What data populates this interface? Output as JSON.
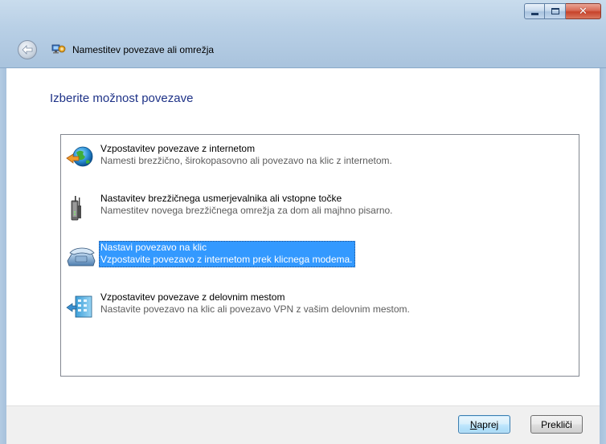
{
  "window": {
    "title": "Namestitev povezave ali omrežja",
    "caption_buttons": {
      "minimize_icon": "minimize-icon",
      "maximize_icon": "maximize-icon",
      "close_icon": "close-icon",
      "close_glyph": "✕"
    },
    "back_icon": "back-arrow-icon"
  },
  "page": {
    "heading": "Izberite možnost povezave"
  },
  "options": [
    {
      "title": "Vzpostavitev povezave z internetom",
      "description": "Namesti brezžično, širokopasovno ali povezavo na klic z internetom.",
      "icon": "globe-connect-icon",
      "selected": false
    },
    {
      "title": "Nastavitev brezžičnega usmerjevalnika ali vstopne točke",
      "description": "Namestitev novega brezžičnega omrežja za dom ali majhno pisarno.",
      "icon": "wireless-router-icon",
      "selected": false
    },
    {
      "title": "Nastavi povezavo na klic",
      "description": "Vzpostavite povezavo z internetom prek klicnega modema.",
      "icon": "dialup-phone-icon",
      "selected": true
    },
    {
      "title": "Vzpostavitev povezave z delovnim mestom",
      "description": "Nastavite povezavo na klic ali povezavo VPN z vašim delovnim mestom.",
      "icon": "workplace-network-icon",
      "selected": false
    }
  ],
  "footer": {
    "next_label_accel": "N",
    "next_label_rest": "aprej",
    "cancel_label": "Prekliči"
  },
  "colors": {
    "heading": "#1e3287",
    "selection": "#3399ff",
    "frame": "#b9d0e6"
  }
}
